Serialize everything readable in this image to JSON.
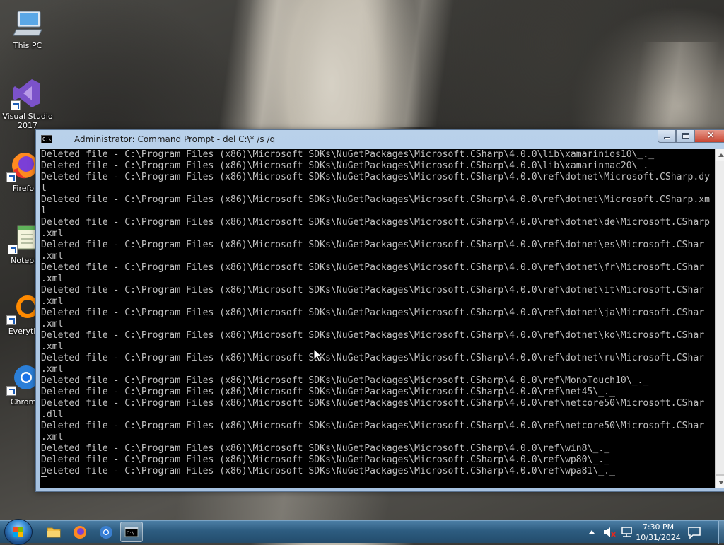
{
  "desktop": {
    "icons": [
      {
        "label": "This PC",
        "icon": "computer-icon"
      },
      {
        "label": "Visual Studio 2017",
        "icon": "visual-studio-icon"
      },
      {
        "label": "Firefo",
        "icon": "firefox-icon"
      },
      {
        "label": "Notepa",
        "icon": "notepad-icon"
      },
      {
        "label": "Everyth",
        "icon": "everything-icon"
      },
      {
        "label": "Chrom",
        "icon": "chrome-icon"
      }
    ]
  },
  "window": {
    "title": "Administrator: Command Prompt - del  C:\\* /s /q",
    "title_icon_text": "C:\\",
    "buttons": {
      "minimize": "minimize-icon",
      "maximize": "maximize-icon",
      "close": "×"
    }
  },
  "console": {
    "lines": [
      "Deleted file - C:\\Program Files (x86)\\Microsoft SDKs\\NuGetPackages\\Microsoft.CSharp\\4.0.0\\lib\\xamarinios10\\_._",
      "Deleted file - C:\\Program Files (x86)\\Microsoft SDKs\\NuGetPackages\\Microsoft.CSharp\\4.0.0\\lib\\xamarinmac20\\_._",
      "Deleted file - C:\\Program Files (x86)\\Microsoft SDKs\\NuGetPackages\\Microsoft.CSharp\\4.0.0\\ref\\dotnet\\Microsoft.CSharp.dy",
      "l",
      "Deleted file - C:\\Program Files (x86)\\Microsoft SDKs\\NuGetPackages\\Microsoft.CSharp\\4.0.0\\ref\\dotnet\\Microsoft.CSharp.xm",
      "l",
      "Deleted file - C:\\Program Files (x86)\\Microsoft SDKs\\NuGetPackages\\Microsoft.CSharp\\4.0.0\\ref\\dotnet\\de\\Microsoft.CSharp",
      ".xml",
      "Deleted file - C:\\Program Files (x86)\\Microsoft SDKs\\NuGetPackages\\Microsoft.CSharp\\4.0.0\\ref\\dotnet\\es\\Microsoft.CShar",
      ".xml",
      "Deleted file - C:\\Program Files (x86)\\Microsoft SDKs\\NuGetPackages\\Microsoft.CSharp\\4.0.0\\ref\\dotnet\\fr\\Microsoft.CShar",
      ".xml",
      "Deleted file - C:\\Program Files (x86)\\Microsoft SDKs\\NuGetPackages\\Microsoft.CSharp\\4.0.0\\ref\\dotnet\\it\\Microsoft.CShar",
      ".xml",
      "Deleted file - C:\\Program Files (x86)\\Microsoft SDKs\\NuGetPackages\\Microsoft.CSharp\\4.0.0\\ref\\dotnet\\ja\\Microsoft.CShar",
      ".xml",
      "Deleted file - C:\\Program Files (x86)\\Microsoft SDKs\\NuGetPackages\\Microsoft.CSharp\\4.0.0\\ref\\dotnet\\ko\\Microsoft.CShar",
      ".xml",
      "Deleted file - C:\\Program Files (x86)\\Microsoft SDKs\\NuGetPackages\\Microsoft.CSharp\\4.0.0\\ref\\dotnet\\ru\\Microsoft.CShar",
      ".xml",
      "Deleted file - C:\\Program Files (x86)\\Microsoft SDKs\\NuGetPackages\\Microsoft.CSharp\\4.0.0\\ref\\MonoTouch10\\_._",
      "Deleted file - C:\\Program Files (x86)\\Microsoft SDKs\\NuGetPackages\\Microsoft.CSharp\\4.0.0\\ref\\net45\\_._",
      "Deleted file - C:\\Program Files (x86)\\Microsoft SDKs\\NuGetPackages\\Microsoft.CSharp\\4.0.0\\ref\\netcore50\\Microsoft.CShar",
      ".dll",
      "Deleted file - C:\\Program Files (x86)\\Microsoft SDKs\\NuGetPackages\\Microsoft.CSharp\\4.0.0\\ref\\netcore50\\Microsoft.CShar",
      ".xml",
      "Deleted file - C:\\Program Files (x86)\\Microsoft SDKs\\NuGetPackages\\Microsoft.CSharp\\4.0.0\\ref\\win8\\_._",
      "Deleted file - C:\\Program Files (x86)\\Microsoft SDKs\\NuGetPackages\\Microsoft.CSharp\\4.0.0\\ref\\wp80\\_._",
      "Deleted file - C:\\Program Files (x86)\\Microsoft SDKs\\NuGetPackages\\Microsoft.CSharp\\4.0.0\\ref\\wpa81\\_._"
    ],
    "text_color": "#c0c0c0",
    "background": "#000000"
  },
  "taskbar": {
    "pinned": [
      {
        "name": "file-explorer-icon"
      },
      {
        "name": "firefox-icon"
      },
      {
        "name": "chrome-icon"
      },
      {
        "name": "command-prompt-icon",
        "active": true
      }
    ],
    "tray": {
      "time": "7:30 PM",
      "date": "10/31/2024",
      "icons": [
        "show-hidden-icons-chevron-icon",
        "volume-muted-icon",
        "network-icon",
        "action-center-icon"
      ]
    }
  }
}
